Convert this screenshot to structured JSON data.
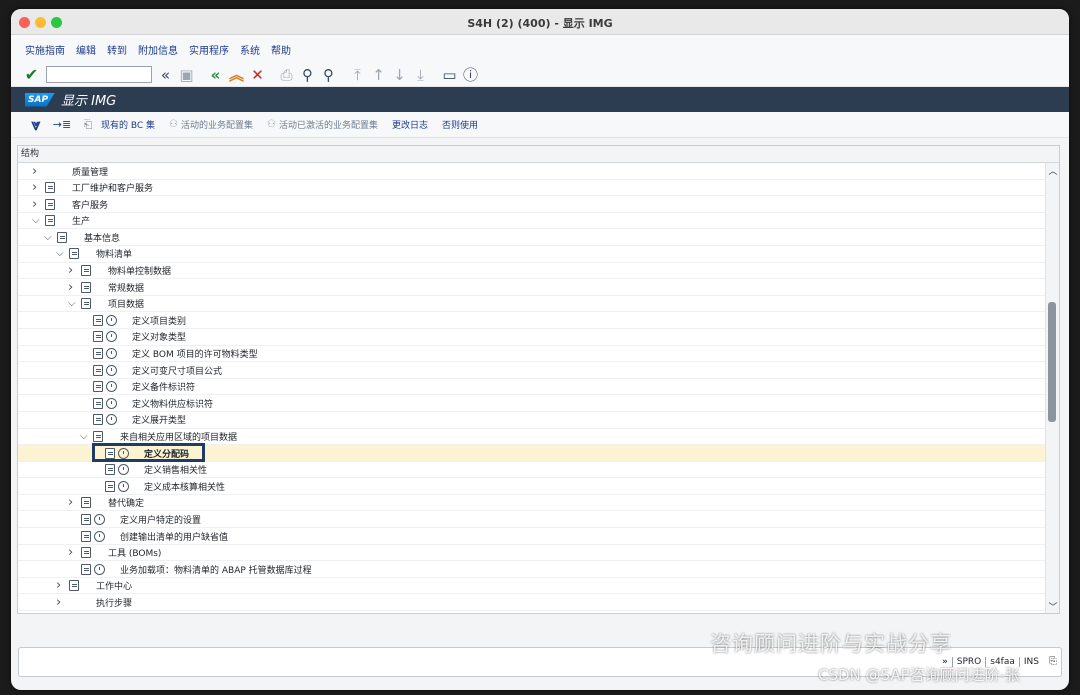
{
  "window": {
    "title": "S4H (2) (400) - 显示 IMG"
  },
  "menu": [
    "实施指南",
    "编辑",
    "转到",
    "附加信息",
    "实用程序",
    "系统",
    "帮助"
  ],
  "toolbar": {
    "command_value": ""
  },
  "app": {
    "brand": "SAP",
    "title": "显示 IMG"
  },
  "app_toolbar": {
    "bc_sets": "现有的 BC 集",
    "active_bc_sets": "活动的业务配置集",
    "activated_bc_sets": "活动已激活的业务配置集",
    "change_log": "更改日志",
    "where_used": "否则使用"
  },
  "tree": {
    "header": "结构",
    "rows": [
      {
        "level": 0,
        "expander": ">",
        "icon": false,
        "clock": false,
        "label": "质量管理"
      },
      {
        "level": 0,
        "expander": ">",
        "icon": true,
        "clock": false,
        "label": "工厂维护和客户服务"
      },
      {
        "level": 0,
        "expander": ">",
        "icon": true,
        "clock": false,
        "label": "客户服务"
      },
      {
        "level": 0,
        "expander": "v",
        "icon": true,
        "clock": false,
        "label": "生产"
      },
      {
        "level": 1,
        "expander": "v",
        "icon": true,
        "clock": false,
        "label": "基本信息"
      },
      {
        "level": 2,
        "expander": "v",
        "icon": true,
        "clock": false,
        "label": "物料清单"
      },
      {
        "level": 3,
        "expander": ">",
        "icon": true,
        "clock": false,
        "label": "物料单控制数据"
      },
      {
        "level": 3,
        "expander": ">",
        "icon": true,
        "clock": false,
        "label": "常规数据"
      },
      {
        "level": 3,
        "expander": "v",
        "icon": true,
        "clock": false,
        "label": "项目数据"
      },
      {
        "level": 4,
        "expander": "",
        "icon": true,
        "clock": true,
        "label": "定义项目类别"
      },
      {
        "level": 4,
        "expander": "",
        "icon": true,
        "clock": true,
        "label": "定义对象类型"
      },
      {
        "level": 4,
        "expander": "",
        "icon": true,
        "clock": true,
        "label": "定义 BOM 项目的许可物料类型"
      },
      {
        "level": 4,
        "expander": "",
        "icon": true,
        "clock": true,
        "label": "定义可变尺寸项目公式"
      },
      {
        "level": 4,
        "expander": "",
        "icon": true,
        "clock": true,
        "label": "定义备件标识符"
      },
      {
        "level": 4,
        "expander": "",
        "icon": true,
        "clock": true,
        "label": "定义物料供应标识符"
      },
      {
        "level": 4,
        "expander": "",
        "icon": true,
        "clock": true,
        "label": "定义展开类型"
      },
      {
        "level": 4,
        "expander": "v",
        "icon": true,
        "clock": false,
        "label": "来自相关应用区域的项目数据"
      },
      {
        "level": 5,
        "expander": "",
        "icon": true,
        "clock": true,
        "label": "定义分配码",
        "selected": true
      },
      {
        "level": 5,
        "expander": "",
        "icon": true,
        "clock": true,
        "label": "定义销售相关性"
      },
      {
        "level": 5,
        "expander": "",
        "icon": true,
        "clock": true,
        "label": "定义成本核算相关性"
      },
      {
        "level": 3,
        "expander": ">",
        "icon": true,
        "clock": false,
        "label": "替代确定"
      },
      {
        "level": 3,
        "expander": "",
        "icon": true,
        "clock": true,
        "label": "定义用户特定的设置"
      },
      {
        "level": 3,
        "expander": "",
        "icon": true,
        "clock": true,
        "label": "创建输出清单的用户缺省值"
      },
      {
        "level": 3,
        "expander": ">",
        "icon": true,
        "clock": false,
        "label": "工具 (BOMs)"
      },
      {
        "level": 3,
        "expander": "",
        "icon": true,
        "clock": true,
        "label": "业务加载项：物料清单的 ABAP 托管数据库过程"
      },
      {
        "level": 2,
        "expander": ">",
        "icon": true,
        "clock": false,
        "label": "工作中心"
      },
      {
        "level": 2,
        "expander": ">",
        "icon": false,
        "clock": false,
        "label": "执行步骤"
      }
    ]
  },
  "status": {
    "transaction": "SPRO",
    "server": "s4faa",
    "mode": "INS"
  },
  "watermark": {
    "line1": "咨询顾问进阶与实战分享",
    "line2": "CSDN @SAP咨询顾问进阶-张"
  }
}
